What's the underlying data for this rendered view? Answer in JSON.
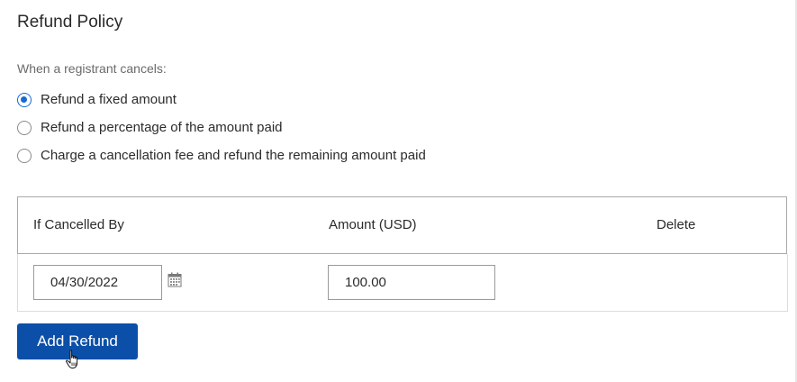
{
  "section": {
    "title": "Refund Policy",
    "prompt": "When a registrant cancels:"
  },
  "options": [
    {
      "label": "Refund a fixed amount",
      "checked": true
    },
    {
      "label": "Refund a percentage of the amount paid",
      "checked": false
    },
    {
      "label": "Charge a cancellation fee and refund the remaining amount paid",
      "checked": false
    }
  ],
  "table": {
    "headers": {
      "date": "If Cancelled By",
      "amount": "Amount (USD)",
      "delete": "Delete"
    },
    "rows": [
      {
        "date": "04/30/2022",
        "amount": "100.00"
      }
    ]
  },
  "actions": {
    "add_label": "Add Refund"
  },
  "colors": {
    "primary": "#0b4fa8",
    "radio_selected": "#1769d6"
  },
  "icons": {
    "calendar": "calendar-icon",
    "cursor": "hand-pointer-icon"
  }
}
